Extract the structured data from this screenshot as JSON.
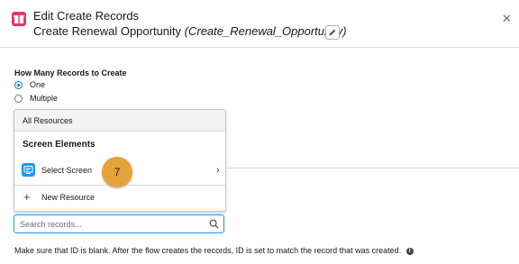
{
  "header": {
    "title": "Edit Create Records",
    "subtitle_label": "Create Renewal Opportunity",
    "subtitle_api": "(Create_Renewal_Opportunity)"
  },
  "records_section": {
    "label": "How Many Records to Create",
    "options": [
      {
        "label": "One",
        "selected": true
      },
      {
        "label": "Multiple",
        "selected": false
      }
    ]
  },
  "resource_dropdown": {
    "header": "All Resources",
    "group_label": "Screen Elements",
    "items": [
      {
        "label": "Select Screen",
        "icon": "screen-icon"
      }
    ],
    "new_resource_label": "New Resource"
  },
  "step_badge": "7",
  "search": {
    "placeholder": "Search records...",
    "value": ""
  },
  "help_text": "Make sure that ID is blank. After the flow creates the records, ID is set to match the record that was created.",
  "colors": {
    "brand_pink": "#e3366d",
    "accent_blue": "#1b96ff",
    "badge_orange": "#e5a33b"
  }
}
